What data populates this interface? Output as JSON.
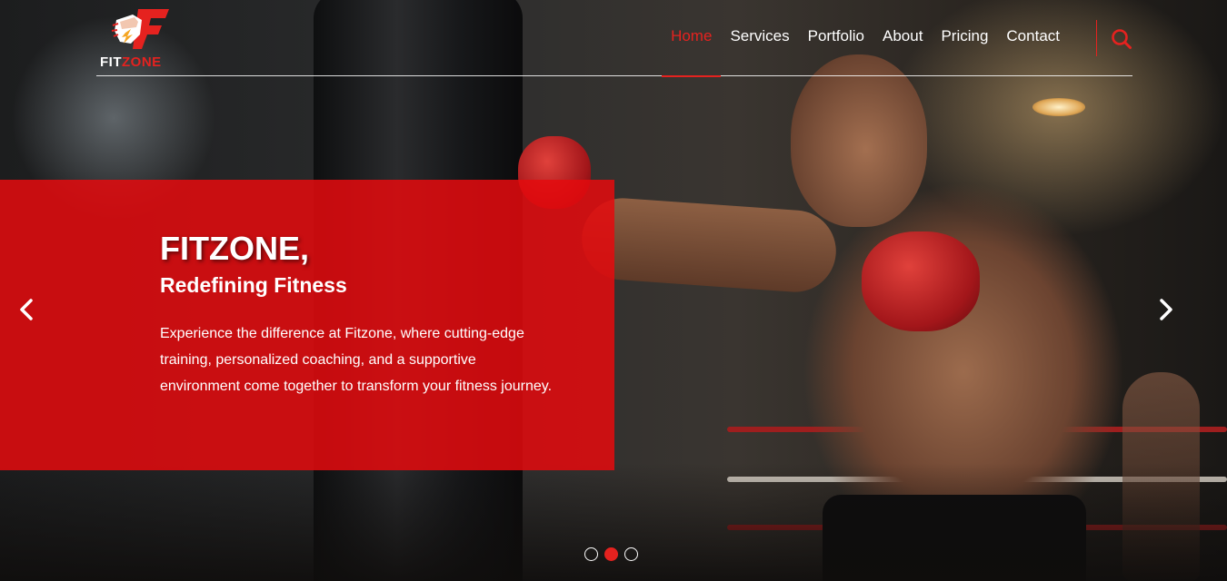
{
  "brand": {
    "logo_text_main": "FIT",
    "logo_text_accent": "ZONE",
    "accent_color": "#e5221f"
  },
  "nav": {
    "items": [
      {
        "label": "Home",
        "active": true
      },
      {
        "label": "Services",
        "active": false
      },
      {
        "label": "Portfolio",
        "active": false
      },
      {
        "label": "About",
        "active": false
      },
      {
        "label": "Pricing",
        "active": false
      },
      {
        "label": "Contact",
        "active": false
      }
    ],
    "search_icon": "search-icon"
  },
  "hero": {
    "title": "FITZONE,",
    "subtitle": "Redefining Fitness",
    "description": "Experience the difference at Fitzone, where cutting-edge training, personalized coaching, and a supportive environment come together to transform your fitness journey.",
    "caption_color": "#e40a0e"
  },
  "carousel": {
    "prev_icon": "chevron-left-icon",
    "next_icon": "chevron-right-icon",
    "slide_count": 3,
    "active_slide": 2
  }
}
